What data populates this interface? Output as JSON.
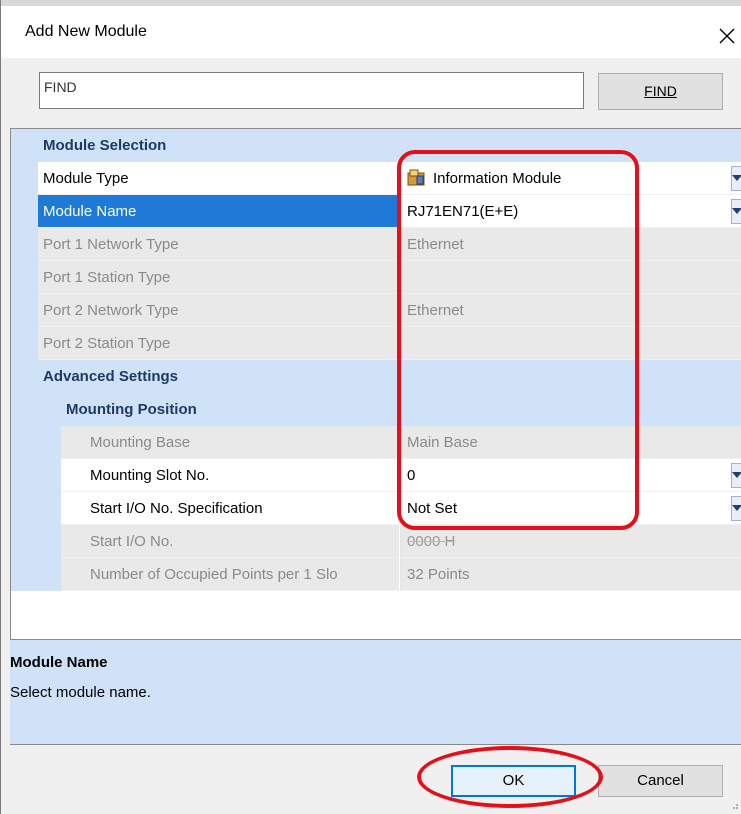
{
  "window": {
    "title": "Add New Module"
  },
  "find": {
    "value": "FIND",
    "button_label": "FIND"
  },
  "grid": {
    "module_selection": {
      "header": "Module Selection",
      "rows": [
        {
          "label": "Module Type",
          "value": "Information Module",
          "state": "editable",
          "dropdown": true
        },
        {
          "label": "Module Name",
          "value": "RJ71EN71(E+E)",
          "state": "selected",
          "dropdown": true
        },
        {
          "label": "Port 1 Network Type",
          "value": "Ethernet",
          "state": "disabled"
        },
        {
          "label": "Port 1 Station Type",
          "value": "",
          "state": "disabled"
        },
        {
          "label": "Port 2 Network Type",
          "value": "Ethernet",
          "state": "disabled"
        },
        {
          "label": "Port 2 Station Type",
          "value": "",
          "state": "disabled"
        }
      ]
    },
    "advanced_settings": {
      "header": "Advanced Settings",
      "mounting_position": {
        "header": "Mounting Position",
        "rows": [
          {
            "label": "Mounting Base",
            "value": "Main Base",
            "state": "disabled"
          },
          {
            "label": "Mounting Slot No.",
            "value": "0",
            "state": "editable",
            "dropdown": true
          },
          {
            "label": "Start I/O No. Specification",
            "value": "Not Set",
            "state": "editable",
            "dropdown": true
          },
          {
            "label": "Start I/O No.",
            "value": "0000 H",
            "state": "disabled"
          },
          {
            "label": "Number of Occupied Points per 1 Slo",
            "value": "32 Points",
            "state": "disabled"
          }
        ]
      }
    }
  },
  "description": {
    "title": "Module Name",
    "text": "Select module name."
  },
  "buttons": {
    "ok": "OK",
    "cancel": "Cancel"
  },
  "colors": {
    "accent": "#0078d7",
    "selection": "#1e7ad6",
    "category_bg": "#cfe2f7",
    "highlight": "#e3101a"
  },
  "icons": {
    "module_type": "information-module-icon",
    "close": "close-icon"
  }
}
